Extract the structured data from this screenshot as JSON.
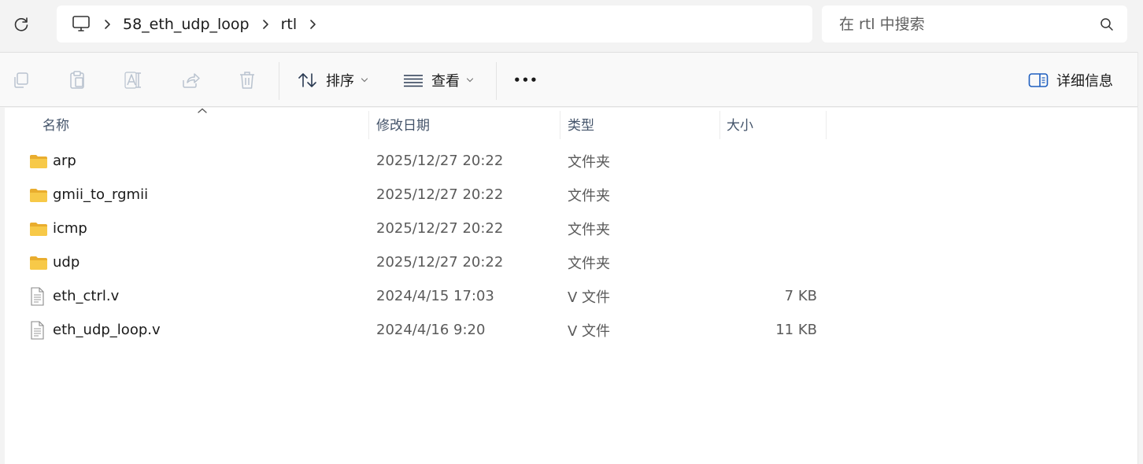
{
  "breadcrumb": {
    "items": [
      "58_eth_udp_loop",
      "rtl"
    ]
  },
  "search": {
    "placeholder": "在 rtl 中搜索"
  },
  "toolbar": {
    "sort_label": "排序",
    "view_label": "查看",
    "more_label": "•••",
    "details_label": "详细信息"
  },
  "columns": {
    "name": "名称",
    "date": "修改日期",
    "type": "类型",
    "size": "大小"
  },
  "files": [
    {
      "name": "arp",
      "date": "2025/12/27 20:22",
      "type": "文件夹",
      "size": "",
      "kind": "folder-icon"
    },
    {
      "name": "gmii_to_rgmii",
      "date": "2025/12/27 20:22",
      "type": "文件夹",
      "size": "",
      "kind": "folder-icon"
    },
    {
      "name": "icmp",
      "date": "2025/12/27 20:22",
      "type": "文件夹",
      "size": "",
      "kind": "folder-icon"
    },
    {
      "name": "udp",
      "date": "2025/12/27 20:22",
      "type": "文件夹",
      "size": "",
      "kind": "folder-icon"
    },
    {
      "name": "eth_ctrl.v",
      "date": "2024/4/15 17:03",
      "type": "V 文件",
      "size": "7 KB",
      "kind": "file-icon"
    },
    {
      "name": "eth_udp_loop.v",
      "date": "2024/4/16 9:20",
      "type": "V 文件",
      "size": "11 KB",
      "kind": "file-icon"
    }
  ],
  "colors": {
    "folder": "#f7c948",
    "header_text": "#44546a",
    "accent": "#1f5fbf"
  }
}
